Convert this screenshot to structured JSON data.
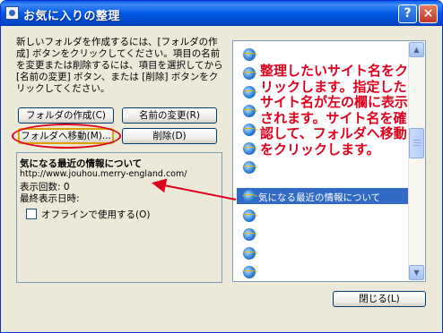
{
  "window": {
    "title": "お気に入りの整理",
    "help_label": "?",
    "close_label": "×"
  },
  "instructions": "新しいフォルダを作成するには、[フォルダの作成] ボタンをクリックしてください。項目の名前を変更または削除するには、項目を選択してから [名前の変更] ボタン、または [削除] ボタンをクリックしてください。",
  "buttons": {
    "create_folder": "フォルダの作成(C)",
    "rename": "名前の変更(R)",
    "move_to_folder": "フォルダへ移動(M)...",
    "delete": "削除(D)",
    "close": "閉じる(L)"
  },
  "info": {
    "title": "気になる最近の情報について",
    "url": "http://www.jouhou.merry-england.com/",
    "visit_count": "表示回数: 0",
    "last_visited": "最終表示日時:",
    "offline_label": "オフラインで使用する(O)",
    "offline_checked": false
  },
  "favorites": {
    "selected_item": "気になる最近の情報について",
    "item_icon": "ie-page-icon"
  },
  "annotation": {
    "text": "整理したいサイト名をクリックします。指定したサイト名が左の欄に表示されます。サイト名を確認して、フォルダへ移動をクリックします。",
    "color": "#e0001b"
  },
  "colors": {
    "titlebar": "#0058e6",
    "selection": "#316ac5",
    "dialog_bg": "#ece9d8"
  }
}
